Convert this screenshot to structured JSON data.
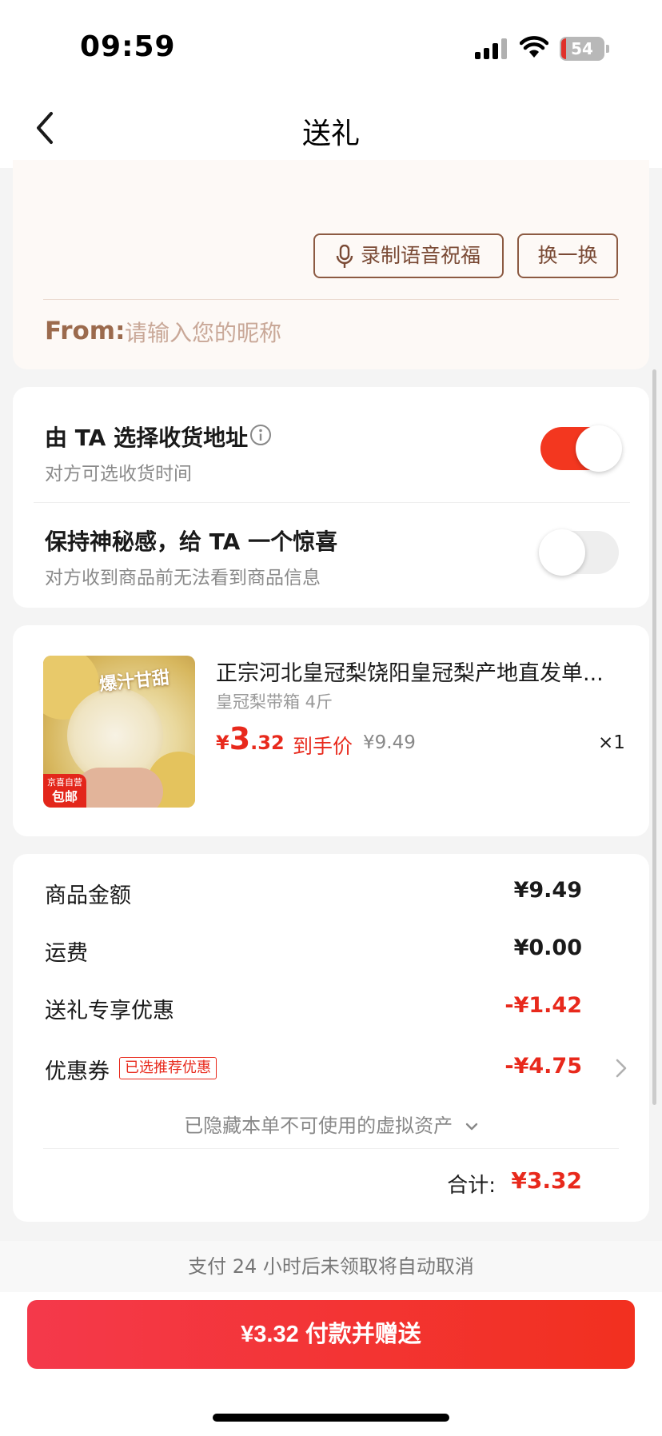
{
  "status_bar": {
    "time": "09:59",
    "battery": "54"
  },
  "header": {
    "title": "送礼"
  },
  "message_card": {
    "voice_button": "录制语音祝福",
    "swap_button": "换一换",
    "from_label": "From:",
    "from_placeholder": "请输入您的昵称"
  },
  "options": {
    "address": {
      "title": "由 TA 选择收货地址",
      "subtitle": "对方可选收货时间",
      "enabled": true
    },
    "surprise": {
      "title": "保持神秘感，给 TA 一个惊喜",
      "subtitle": "对方收到商品前无法看到商品信息",
      "enabled": false
    }
  },
  "product": {
    "title": "正宗河北皇冠梨饶阳皇冠梨产地直发单...",
    "spec": "皇冠梨带箱 4斤",
    "price_symbol": "¥",
    "price_integer": "3",
    "price_decimal": ".32",
    "price_tag": "到手价",
    "original_price": "¥9.49",
    "quantity": "×1",
    "image_slogan": "爆汁甘甜",
    "image_badge_top": "京喜自营",
    "image_badge_bottom": "包邮"
  },
  "summary": {
    "goods_label": "商品金额",
    "goods_value": "¥9.49",
    "shipping_label": "运费",
    "shipping_value": "¥0.00",
    "gift_discount_label": "送礼专享优惠",
    "gift_discount_value": "-¥1.42",
    "coupon_label": "优惠券",
    "coupon_tag": "已选推荐优惠",
    "coupon_value": "-¥4.75",
    "hidden_assets": "已隐藏本单不可使用的虚拟资产",
    "total_label": "合计:",
    "total_value": "¥3.32"
  },
  "footer": {
    "notice": "支付 24 小时后未领取将自动取消",
    "pay_button": "¥3.32 付款并赠送"
  },
  "colors": {
    "accent_red": "#e8291c",
    "brown": "#8c5a42",
    "toggle_on": "#f3371f"
  }
}
